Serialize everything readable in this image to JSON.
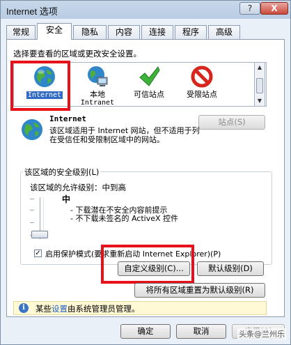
{
  "window": {
    "title": "Internet 选项",
    "help_label": "?",
    "close_label": "X"
  },
  "tabs": [
    {
      "label": "常规"
    },
    {
      "label": "安全"
    },
    {
      "label": "隐私"
    },
    {
      "label": "内容"
    },
    {
      "label": "连接"
    },
    {
      "label": "程序"
    },
    {
      "label": "高级"
    }
  ],
  "security": {
    "instruction": "选择要查看的区域或更改安全设置。",
    "zones": [
      {
        "label": "Internet",
        "sublabel": "",
        "icon": "globe-icon"
      },
      {
        "label": "本地",
        "sublabel": "Intranet",
        "icon": "local-intranet-icon"
      },
      {
        "label": "可信站点",
        "sublabel": "",
        "icon": "check-icon"
      },
      {
        "label": "受限站点",
        "sublabel": "",
        "icon": "forbidden-icon"
      }
    ],
    "sites_button": "站点(S)",
    "selected_zone": {
      "name": "Internet",
      "description": "该区域适用于 Internet 网站，但不适用于列在受信任和受限制区域中的网站。"
    },
    "level_group_label": "该区域的安全级别(L)",
    "allowed_levels": "该区域的允许级别：中到高",
    "level_name": "中",
    "level_bullets": [
      "- 下载潜在不安全内容前提示",
      "- 不下载未签名的 ActiveX 控件"
    ],
    "protected_mode": {
      "checked": true,
      "label": "启用保护模式(要求重新启动 Internet Explorer)(P)"
    },
    "custom_level_button": "自定义级别(C)...",
    "default_level_button": "默认级别(D)",
    "reset_all_button": "将所有区域重置为默认级别(R)"
  },
  "info_bar": {
    "prefix": "某些",
    "link": "设置",
    "suffix": "由系统管理员管理。"
  },
  "footer": {
    "ok": "确定",
    "cancel": "取消",
    "apply": "应用(A)"
  },
  "watermark": "头条@兰州乐",
  "colors": {
    "selection": "#316ac5",
    "highlight_box": "#e8101a",
    "link": "#1f5fbf"
  }
}
